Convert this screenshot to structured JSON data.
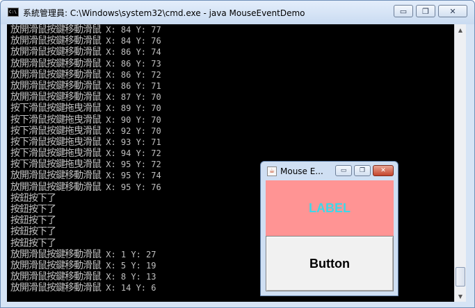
{
  "cmd": {
    "title": "系統管理員: C:\\Windows\\system32\\cmd.exe - java  MouseEventDemo",
    "buttons": {
      "minimize": "▭",
      "maximize": "❐",
      "close": "✕"
    },
    "lines": [
      {
        "text": "放開滑鼠按鍵移動滑鼠",
        "coords": " X: 84 Y: 77"
      },
      {
        "text": "放開滑鼠按鍵移動滑鼠",
        "coords": " X: 84 Y: 76"
      },
      {
        "text": "放開滑鼠按鍵移動滑鼠",
        "coords": " X: 86 Y: 74"
      },
      {
        "text": "放開滑鼠按鍵移動滑鼠",
        "coords": " X: 86 Y: 73"
      },
      {
        "text": "放開滑鼠按鍵移動滑鼠",
        "coords": " X: 86 Y: 72"
      },
      {
        "text": "放開滑鼠按鍵移動滑鼠",
        "coords": " X: 86 Y: 71"
      },
      {
        "text": "放開滑鼠按鍵移動滑鼠",
        "coords": " X: 87 Y: 70"
      },
      {
        "text": "按下滑鼠按鍵拖曳滑鼠",
        "coords": " X: 89 Y: 70"
      },
      {
        "text": "按下滑鼠按鍵拖曳滑鼠",
        "coords": " X: 90 Y: 70"
      },
      {
        "text": "按下滑鼠按鍵拖曳滑鼠",
        "coords": " X: 92 Y: 70"
      },
      {
        "text": "按下滑鼠按鍵拖曳滑鼠",
        "coords": " X: 93 Y: 71"
      },
      {
        "text": "按下滑鼠按鍵拖曳滑鼠",
        "coords": " X: 94 Y: 72"
      },
      {
        "text": "按下滑鼠按鍵拖曳滑鼠",
        "coords": " X: 95 Y: 72"
      },
      {
        "text": "放開滑鼠按鍵移動滑鼠",
        "coords": " X: 95 Y: 74"
      },
      {
        "text": "放開滑鼠按鍵移動滑鼠",
        "coords": " X: 95 Y: 76"
      },
      {
        "text": "按鈕按下了",
        "coords": ""
      },
      {
        "text": "按鈕按下了",
        "coords": ""
      },
      {
        "text": "按鈕按下了",
        "coords": ""
      },
      {
        "text": "按鈕按下了",
        "coords": ""
      },
      {
        "text": "按鈕按下了",
        "coords": ""
      },
      {
        "text": "放開滑鼠按鍵移動滑鼠",
        "coords": " X: 1 Y: 27"
      },
      {
        "text": "放開滑鼠按鍵移動滑鼠",
        "coords": " X: 5 Y: 19"
      },
      {
        "text": "放開滑鼠按鍵移動滑鼠",
        "coords": " X: 8 Y: 13"
      },
      {
        "text": "放開滑鼠按鍵移動滑鼠",
        "coords": " X: 14 Y: 6"
      }
    ],
    "scroll": {
      "up": "▲",
      "down": "▼"
    }
  },
  "java": {
    "title": "Mouse E...",
    "buttons": {
      "minimize": "▭",
      "maximize": "❐",
      "close": "✕"
    },
    "label": "LABEL",
    "button": "Button"
  },
  "colors": {
    "console_bg": "#000000",
    "console_text": "#c0c0c0",
    "label_bg": "#ff9494",
    "label_text": "#3fd7e8"
  },
  "icons": {
    "cmd": "console-icon",
    "java": "java-cup-icon"
  }
}
